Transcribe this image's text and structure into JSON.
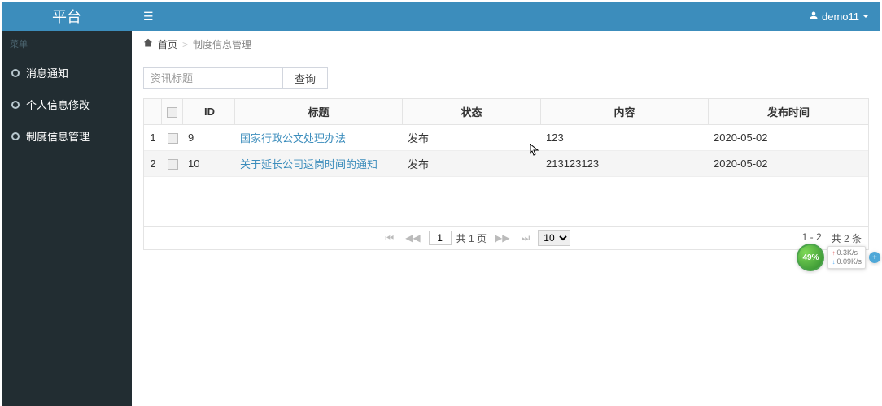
{
  "brand": "平台",
  "user": {
    "name": "demo11"
  },
  "sidebar": {
    "header": "菜单",
    "items": [
      {
        "label": "消息通知"
      },
      {
        "label": "个人信息修改"
      },
      {
        "label": "制度信息管理"
      }
    ]
  },
  "breadcrumb": {
    "home": "首页",
    "sep": ">",
    "current": "制度信息管理"
  },
  "search": {
    "placeholder": "资讯标题",
    "button": "查询"
  },
  "table": {
    "headers": {
      "id": "ID",
      "title": "标题",
      "status": "状态",
      "content": "内容",
      "date": "发布时间"
    },
    "rows": [
      {
        "idx": "1",
        "id": "9",
        "title": "国家行政公文处理办法",
        "status": "发布",
        "content": "123",
        "date": "2020-05-02"
      },
      {
        "idx": "2",
        "id": "10",
        "title": "关于延长公司返岗时间的通知",
        "status": "发布",
        "content": "213123123",
        "date": "2020-05-02"
      }
    ]
  },
  "pager": {
    "page": "1",
    "total_pages_text": "共 1 页",
    "page_size": "10",
    "range": "1 - 2",
    "total_text": "共 2 条"
  },
  "net": {
    "pct": "49%",
    "up": "0.3K/s",
    "down": "0.09K/s"
  }
}
